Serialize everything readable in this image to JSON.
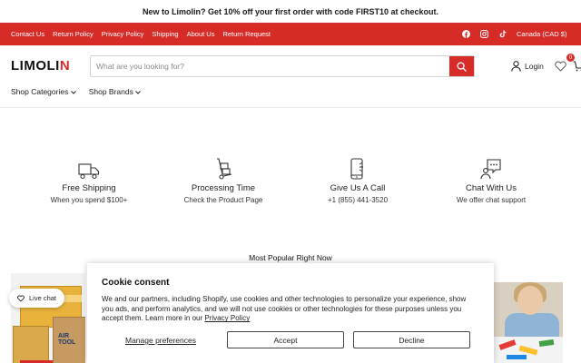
{
  "announcement": "New to Limolin? Get 10% off your first order with code FIRST10 at checkout.",
  "topbar": {
    "links": [
      "Contact Us",
      "Return Policy",
      "Privacy Policy",
      "Shipping",
      "About Us",
      "Return Request"
    ],
    "social_icons": [
      "facebook-icon",
      "instagram-icon",
      "tiktok-icon"
    ],
    "currency": "Canada (CAD $)"
  },
  "header": {
    "logo": "LIMOLIN",
    "search_placeholder": "What are you looking for?",
    "login": "Login",
    "wishlist_count": "0"
  },
  "nav": {
    "categories": "Shop Categories",
    "brands": "Shop Brands"
  },
  "features": [
    {
      "icon": "truck-icon",
      "title": "Free Shipping",
      "subtitle": "When you spend $100+"
    },
    {
      "icon": "hand-truck-icon",
      "title": "Processing Time",
      "subtitle": "Check the Product Page"
    },
    {
      "icon": "phone-icon",
      "title": "Give Us A Call",
      "subtitle": "+1 (855) 441-3520"
    },
    {
      "icon": "chat-bubble-icon",
      "title": "Chat With Us",
      "subtitle": "We offer chat support"
    }
  ],
  "popular_heading": "Most Popular Right Now",
  "product_card_left": {
    "box_label": "AIR TOOL"
  },
  "live_chat": "Live chat",
  "cookie": {
    "title": "Cookie consent",
    "body_text": "We and our partners, including Shopify, use cookies and other technologies to personalize your experience, show you ads, and perform analytics, and we will not use cookies or other technologies for these purposes unless you accept them. Learn more in our",
    "policy_link": "Privacy Policy",
    "manage": "Manage preferences",
    "accept": "Accept",
    "decline": "Decline"
  },
  "colors": {
    "brand_red": "#d72b28",
    "text": "#1f1f1f"
  }
}
